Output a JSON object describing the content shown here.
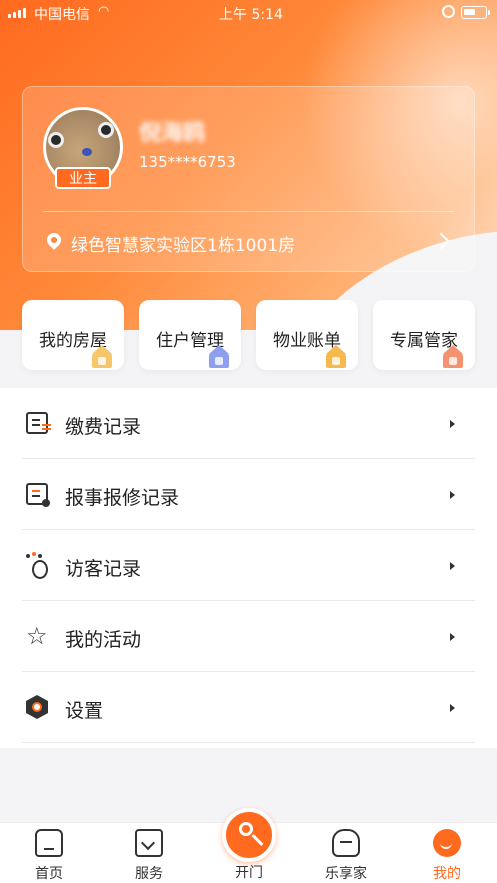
{
  "status_bar": {
    "carrier": "中国电信",
    "time": "上午 5:14"
  },
  "profile": {
    "name": "倪海鸥",
    "phone": "135****6753",
    "role_badge": "业主",
    "address": "绿色智慧家实验区1栋1001房"
  },
  "quick_cards": [
    {
      "label": "我的房屋",
      "icon": "house-icon"
    },
    {
      "label": "住户管理",
      "icon": "resident-icon"
    },
    {
      "label": "物业账单",
      "icon": "bill-icon"
    },
    {
      "label": "专属管家",
      "icon": "butler-icon"
    }
  ],
  "menu": [
    {
      "label": "缴费记录",
      "icon": "payment-record-icon"
    },
    {
      "label": "报事报修记录",
      "icon": "repair-record-icon"
    },
    {
      "label": "访客记录",
      "icon": "visitor-icon"
    },
    {
      "label": "我的活动",
      "icon": "activity-star-icon"
    },
    {
      "label": "设置",
      "icon": "settings-icon"
    }
  ],
  "tabbar": {
    "home": "首页",
    "service": "服务",
    "open_door": "开门",
    "share": "乐享家",
    "mine": "我的",
    "active": "mine",
    "active_color": "#ff6a1f"
  },
  "colors": {
    "accent": "#ff6a1f"
  }
}
